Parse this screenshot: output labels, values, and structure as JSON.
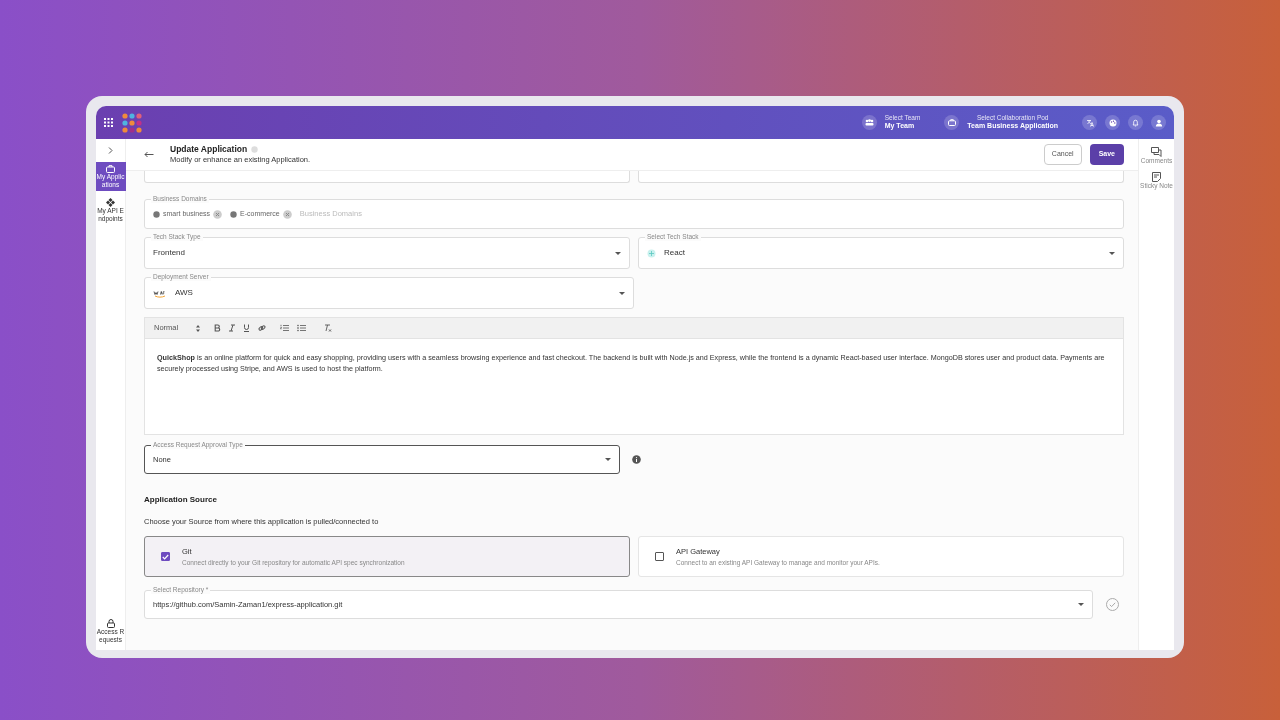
{
  "header": {
    "team_label": "Select Team",
    "team": "My Team",
    "pod_label": "Select Collaboration Pod",
    "pod": "Team Business Application"
  },
  "sidebar": {
    "items": [
      {
        "label": "My Applications",
        "selected": true
      },
      {
        "label": "My API Endpoints",
        "selected": false
      }
    ],
    "footer_item": {
      "label": "Access Requests",
      "selected": false
    }
  },
  "page": {
    "title": "Update Application",
    "subtitle": "Modify or enhance an existing Application.",
    "buttons": [
      {
        "label": "Cancel",
        "kind": "secondary"
      },
      {
        "label": "Save",
        "kind": "primary"
      }
    ]
  },
  "right_rail": [
    {
      "label": "Comments"
    },
    {
      "label": "Sticky Note"
    }
  ],
  "form": {
    "business_domains": {
      "label": "Business Domains",
      "tags": [
        "smart business",
        "E-commerce"
      ],
      "placeholder": "Business Domains"
    },
    "tech_stack_type": {
      "label": "Tech Stack Type",
      "value": "Frontend"
    },
    "tech_stack": {
      "label": "Select Tech Stack",
      "value": "React"
    },
    "deployment_server": {
      "label": "Deployment Server",
      "value": "AWS"
    },
    "editor": {
      "format": "Normal",
      "text": "**QuickShop** is an online platform for quick and easy shopping, providing users with a seamless browsing experience and fast checkout. The backend is built with Node.js and Express, while the frontend is a dynamic React-based user interface. MongoDB stores user and product data. Payments are securely processed using Stripe, and AWS is used to host the platform."
    },
    "approval": {
      "label": "Access Request Approval Type",
      "value": "None"
    },
    "source": {
      "title": "Application Source",
      "subtitle": "Choose your Source from where this application is pulled/connected to",
      "options": [
        {
          "title": "Git",
          "description": "Connect directly to your Git repository for automatic API spec synchronization",
          "checked": true
        },
        {
          "title": "API Gateway",
          "description": "Connect to an existing API Gateway to manage and monitor your APIs.",
          "checked": false
        }
      ]
    },
    "repository": {
      "label": "Select Repository *",
      "value": "https://github.com/Samin-Zaman1/express-application.git"
    }
  }
}
